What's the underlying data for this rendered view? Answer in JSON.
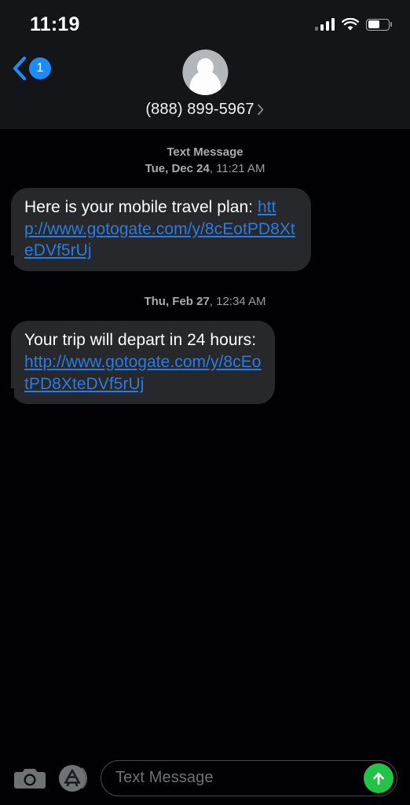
{
  "status_bar": {
    "time": "11:19",
    "signal_icon": "cellular-signal-icon",
    "wifi_icon": "wifi-icon",
    "battery_icon": "battery-icon",
    "battery_percent": 58
  },
  "nav": {
    "back_icon": "chevron-left-icon",
    "unread_count": "1",
    "avatar_icon": "contact-avatar-icon",
    "contact_name": "(888) 899-5967",
    "disclosure_icon": "chevron-right-icon"
  },
  "thread": {
    "messages": [
      {
        "service_label": "Text Message",
        "date": "Tue, Dec 24",
        "time": "11:21 AM",
        "text_prefix": "Here is your mobile travel plan: ",
        "link": "http://www.gotogate.com/y/8cEotPD8XteDVf5rUj"
      },
      {
        "service_label": "",
        "date": "Thu, Feb 27",
        "time": "12:34 AM",
        "text_prefix": "Your trip will depart in 24 hours: ",
        "link": "http://www.gotogate.com/y/8cEotPD8XteDVf5rUj"
      }
    ]
  },
  "input_bar": {
    "camera_icon": "camera-icon",
    "appstore_icon": "app-store-icon",
    "placeholder": "Text Message",
    "send_icon": "arrow-up-icon"
  },
  "colors": {
    "background": "#000005",
    "header": "#131518",
    "bubble": "#26282c",
    "link": "#2b7be0",
    "accent_blue": "#1d8cf5",
    "send_green": "#22c346",
    "secondary_text": "#9a9da1"
  }
}
